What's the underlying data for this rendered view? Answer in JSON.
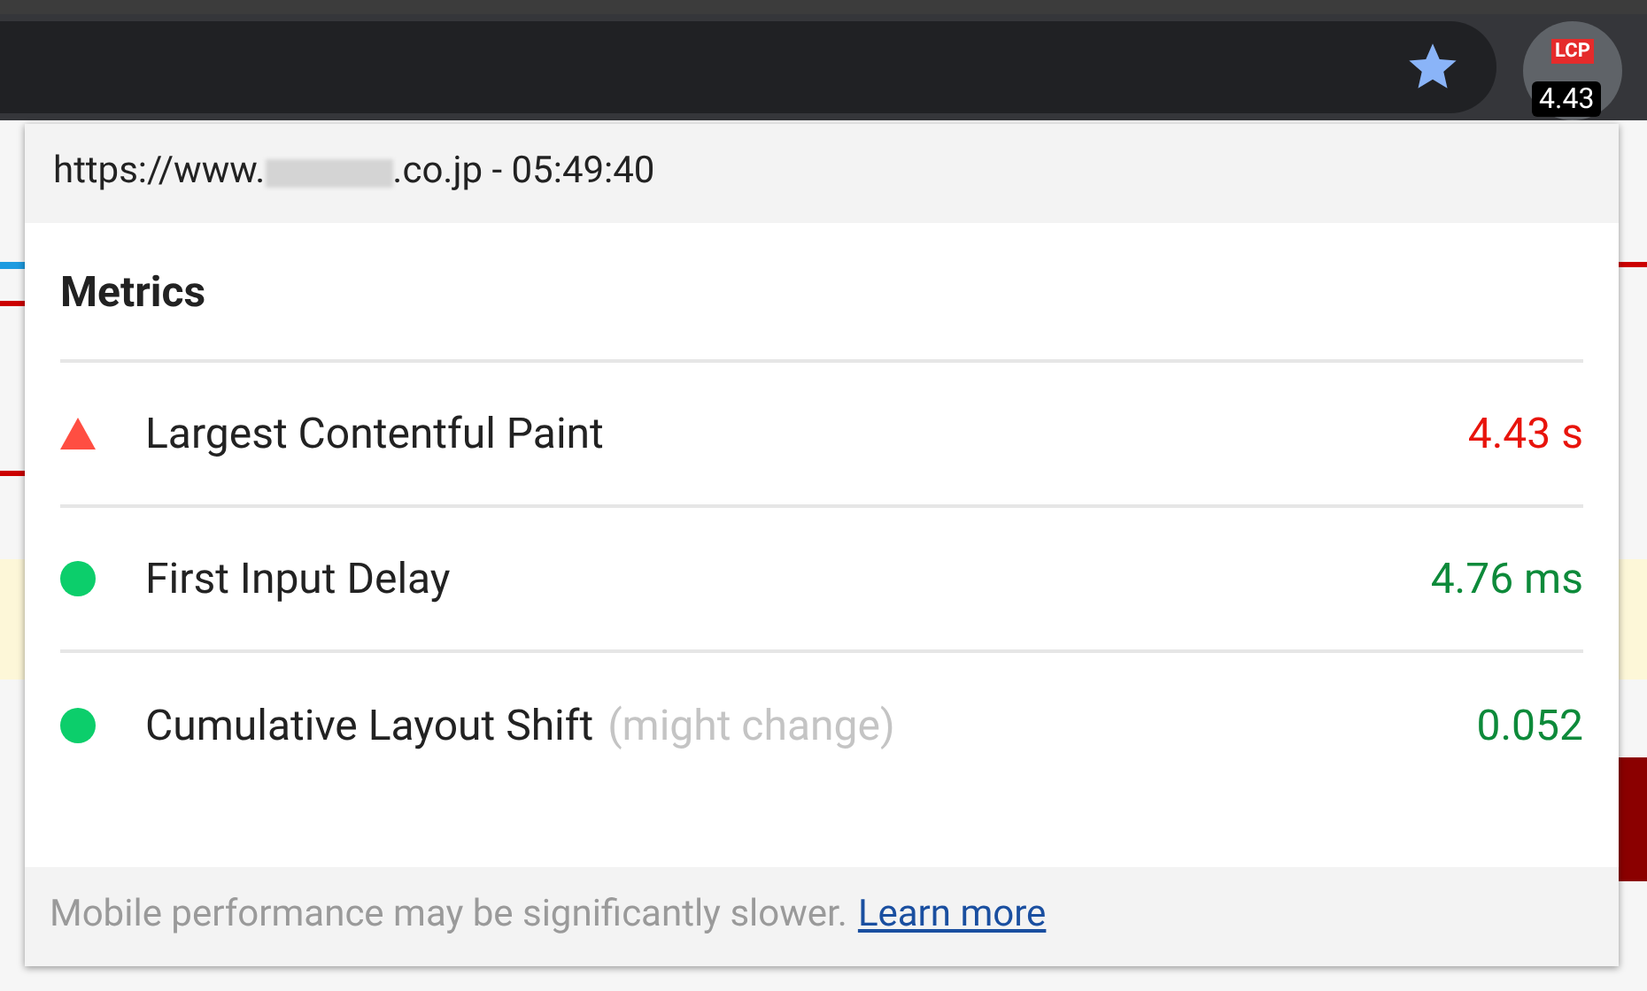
{
  "toolbar": {
    "bookmarked": true,
    "extension_badge": {
      "label": "LCP",
      "value": "4.43"
    }
  },
  "popup": {
    "url_prefix": "https://www.",
    "url_suffix": ".co.jp - 05:49:40",
    "title": "Metrics",
    "metrics": [
      {
        "name": "Largest Contentful Paint",
        "kind": "poor",
        "value": "4.43 s"
      },
      {
        "name": "First Input Delay",
        "kind": "good",
        "value": "4.76 ms"
      },
      {
        "name": "Cumulative Layout Shift",
        "note": "(might change)",
        "kind": "good",
        "value": "0.052"
      }
    ],
    "footer": {
      "text": "Mobile performance may be significantly slower.",
      "link": "Learn more"
    }
  }
}
